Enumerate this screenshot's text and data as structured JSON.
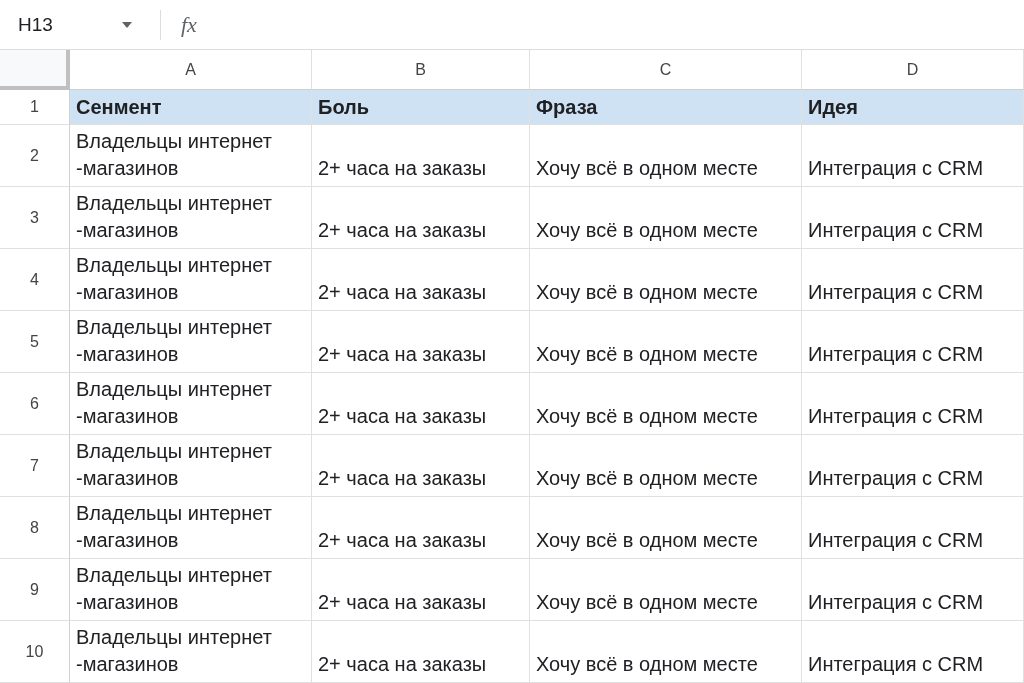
{
  "formula_bar": {
    "name_box": "H13",
    "function_label": "fx"
  },
  "columns": [
    "A",
    "B",
    "C",
    "D"
  ],
  "rows": [
    {
      "number": "1",
      "kind": "header",
      "cells": [
        "Сенмент",
        "Боль",
        "Фраза",
        "Идея"
      ]
    },
    {
      "number": "2",
      "kind": "data",
      "cells": [
        "Владельцы интернет\n-магазинов",
        "2+ часа на заказы",
        "Хочу всё в одном месте",
        "Интеграция с CRM"
      ]
    },
    {
      "number": "3",
      "kind": "data",
      "cells": [
        "Владельцы интернет\n-магазинов",
        "2+ часа на заказы",
        "Хочу всё в одном месте",
        "Интеграция с CRM"
      ]
    },
    {
      "number": "4",
      "kind": "data",
      "cells": [
        "Владельцы интернет\n-магазинов",
        "2+ часа на заказы",
        "Хочу всё в одном месте",
        "Интеграция с CRM"
      ]
    },
    {
      "number": "5",
      "kind": "data",
      "cells": [
        "Владельцы интернет\n-магазинов",
        "2+ часа на заказы",
        "Хочу всё в одном месте",
        "Интеграция с CRM"
      ]
    },
    {
      "number": "6",
      "kind": "data",
      "cells": [
        "Владельцы интернет\n-магазинов",
        "2+ часа на заказы",
        "Хочу всё в одном месте",
        "Интеграция с CRM"
      ]
    },
    {
      "number": "7",
      "kind": "data",
      "cells": [
        "Владельцы интернет\n-магазинов",
        "2+ часа на заказы",
        "Хочу всё в одном месте",
        "Интеграция с CRM"
      ]
    },
    {
      "number": "8",
      "kind": "data",
      "cells": [
        "Владельцы интернет\n-магазинов",
        "2+ часа на заказы",
        "Хочу всё в одном месте",
        "Интеграция с CRM"
      ]
    },
    {
      "number": "9",
      "kind": "data",
      "cells": [
        "Владельцы интернет\n-магазинов",
        "2+ часа на заказы",
        "Хочу всё в одном месте",
        "Интеграция с CRM"
      ]
    },
    {
      "number": "10",
      "kind": "data",
      "cells": [
        "Владельцы интернет\n-магазинов",
        "2+ часа на заказы",
        "Хочу всё в одном месте",
        "Интеграция с CRM"
      ]
    }
  ]
}
